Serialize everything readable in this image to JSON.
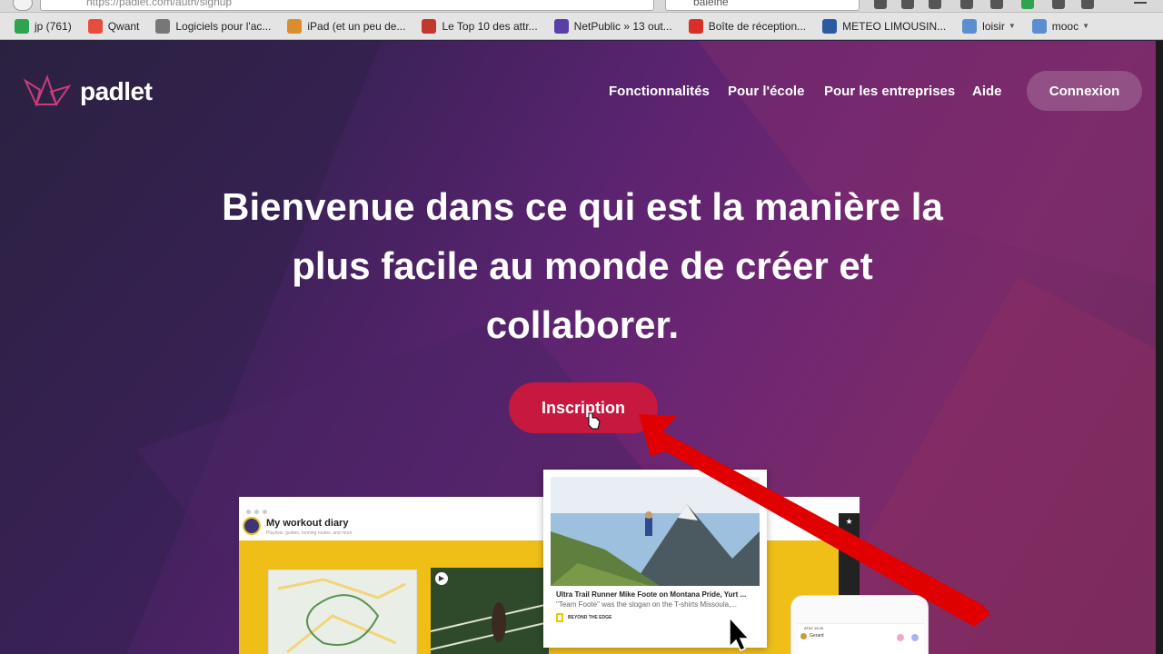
{
  "browser": {
    "url": "https://padlet.com/auth/signup",
    "search_value": "baleine",
    "bookmarks": [
      {
        "label": "jp (761)",
        "icon": "plus-icon",
        "color": "#2ea44f"
      },
      {
        "label": "Qwant",
        "icon": "qwant-icon",
        "color": "#e74c3c"
      },
      {
        "label": "Logiciels pour l'ac...",
        "icon": "globe-icon",
        "color": "#777777"
      },
      {
        "label": "iPad (et un peu de...",
        "icon": "ipad-site-icon",
        "color": "#d98d2c"
      },
      {
        "label": "Le Top 10 des attr...",
        "icon": "top10-site-icon",
        "color": "#c0392b"
      },
      {
        "label": "NetPublic » 13 out...",
        "icon": "netpublic-icon",
        "color": "#5b3fa8"
      },
      {
        "label": "Boîte de réception...",
        "icon": "gmail-icon",
        "color": "#d93025"
      },
      {
        "label": "METEO LIMOUSIN...",
        "icon": "meteo-icon",
        "color": "#2c5aa0"
      },
      {
        "label": "loisir",
        "icon": "folder-icon",
        "color": "#5a8ed0"
      },
      {
        "label": "mooc",
        "icon": "folder-icon",
        "color": "#5a8ed0"
      }
    ]
  },
  "site": {
    "logo_text": "padlet",
    "nav": [
      "Fonctionnalités",
      "Pour l'école",
      "Pour les entreprises",
      "Aide"
    ],
    "login_label": "Connexion",
    "headline_lines": [
      "Bienvenue dans ce qui est la manière la",
      "plus facile au monde de créer et",
      "collaborer."
    ],
    "cta_label": "Inscription"
  },
  "preview": {
    "board_title": "My workout diary",
    "board_subtitle": "Playlists, guides, running routes, and more",
    "card_title": "Ultra Trail Runner Mike Foote on Montana Pride, Yurt ...",
    "card_desc": "\"Team Foote\" was the slogan on the T-shirts Missoula,...",
    "card_source": "BEYOND THE EDGE",
    "phone_status": "AT&T 19:26",
    "phone_user": "Gerard"
  },
  "colors": {
    "cta": "#c7183f",
    "accent_yellow": "#f0bf17",
    "arrow": "#e00000",
    "logo": "#c83c7a"
  }
}
